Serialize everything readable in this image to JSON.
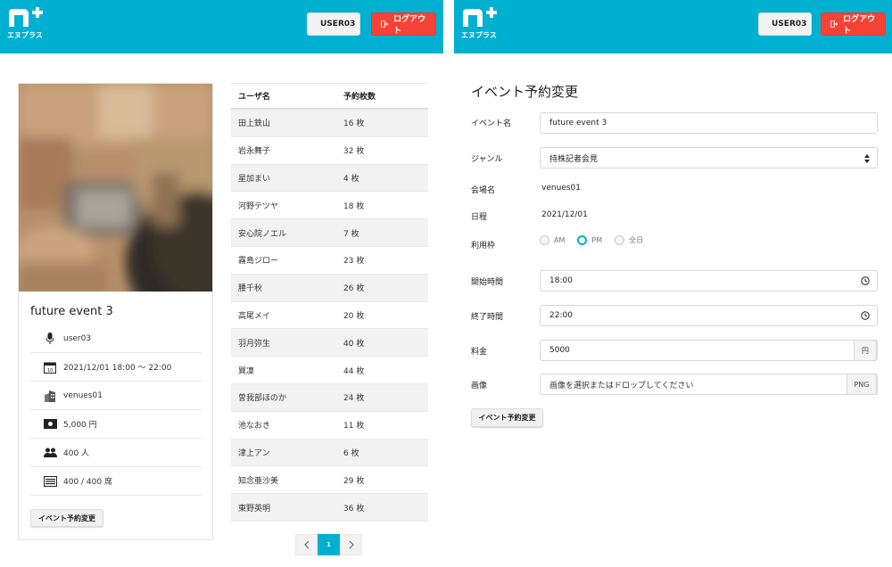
{
  "app": {
    "logo_text": "エヌプラス"
  },
  "header": {
    "user_label": "USER03",
    "logout_label": "ログアウト"
  },
  "event_card": {
    "title": "future event 3",
    "organizer": "user03",
    "datetime": "2021/12/01 18:00 〜 22:00",
    "venue": "venues01",
    "price": "5,000 円",
    "capacity": "400 人",
    "seats": "400 / 400 席",
    "change_button": "イベント予約変更"
  },
  "reservations": {
    "headers": [
      "ユーザ名",
      "予約枚数"
    ],
    "rows": [
      {
        "name": "田上鉄山",
        "count": "16 枚"
      },
      {
        "name": "岩永舞子",
        "count": "32 枚"
      },
      {
        "name": "星加まい",
        "count": "4 枚"
      },
      {
        "name": "河野テツヤ",
        "count": "18 枚"
      },
      {
        "name": "安心院ノエル",
        "count": "7 枚"
      },
      {
        "name": "霧島ジロー",
        "count": "23 枚"
      },
      {
        "name": "腰千秋",
        "count": "26 枚"
      },
      {
        "name": "高尾メイ",
        "count": "20 枚"
      },
      {
        "name": "羽月弥生",
        "count": "40 枚"
      },
      {
        "name": "巽凜",
        "count": "44 枚"
      },
      {
        "name": "曽我部ほのか",
        "count": "24 枚"
      },
      {
        "name": "池なおき",
        "count": "11 枚"
      },
      {
        "name": "津上アン",
        "count": "6 枚"
      },
      {
        "name": "知念亜沙美",
        "count": "29 枚"
      },
      {
        "name": "東野英明",
        "count": "36 枚"
      }
    ],
    "pager": {
      "prev": "‹",
      "current": "1",
      "next": "›"
    }
  },
  "form": {
    "title": "イベント予約変更",
    "event_name_label": "イベント名",
    "event_name_value": "future event 3",
    "genre_label": "ジャンル",
    "genre_value": "持株記者会見",
    "venue_label": "会場名",
    "venue_value": "venues01",
    "date_label": "日程",
    "date_value": "2021/12/01",
    "slot_label": "利用枠",
    "slot_options": [
      "AM",
      "PM",
      "全日"
    ],
    "slot_selected": "PM",
    "start_label": "開始時間",
    "start_value": "18:00",
    "end_label": "終了時間",
    "end_value": "22:00",
    "fee_label": "料金",
    "fee_value": "5000",
    "fee_unit": "円",
    "image_label": "画像",
    "image_placeholder": "画像を選択またはドロップしてください",
    "image_ext": "PNG",
    "submit_label": "イベント予約変更"
  },
  "colors": {
    "brand": "#00b0d1",
    "danger": "#f44336"
  }
}
